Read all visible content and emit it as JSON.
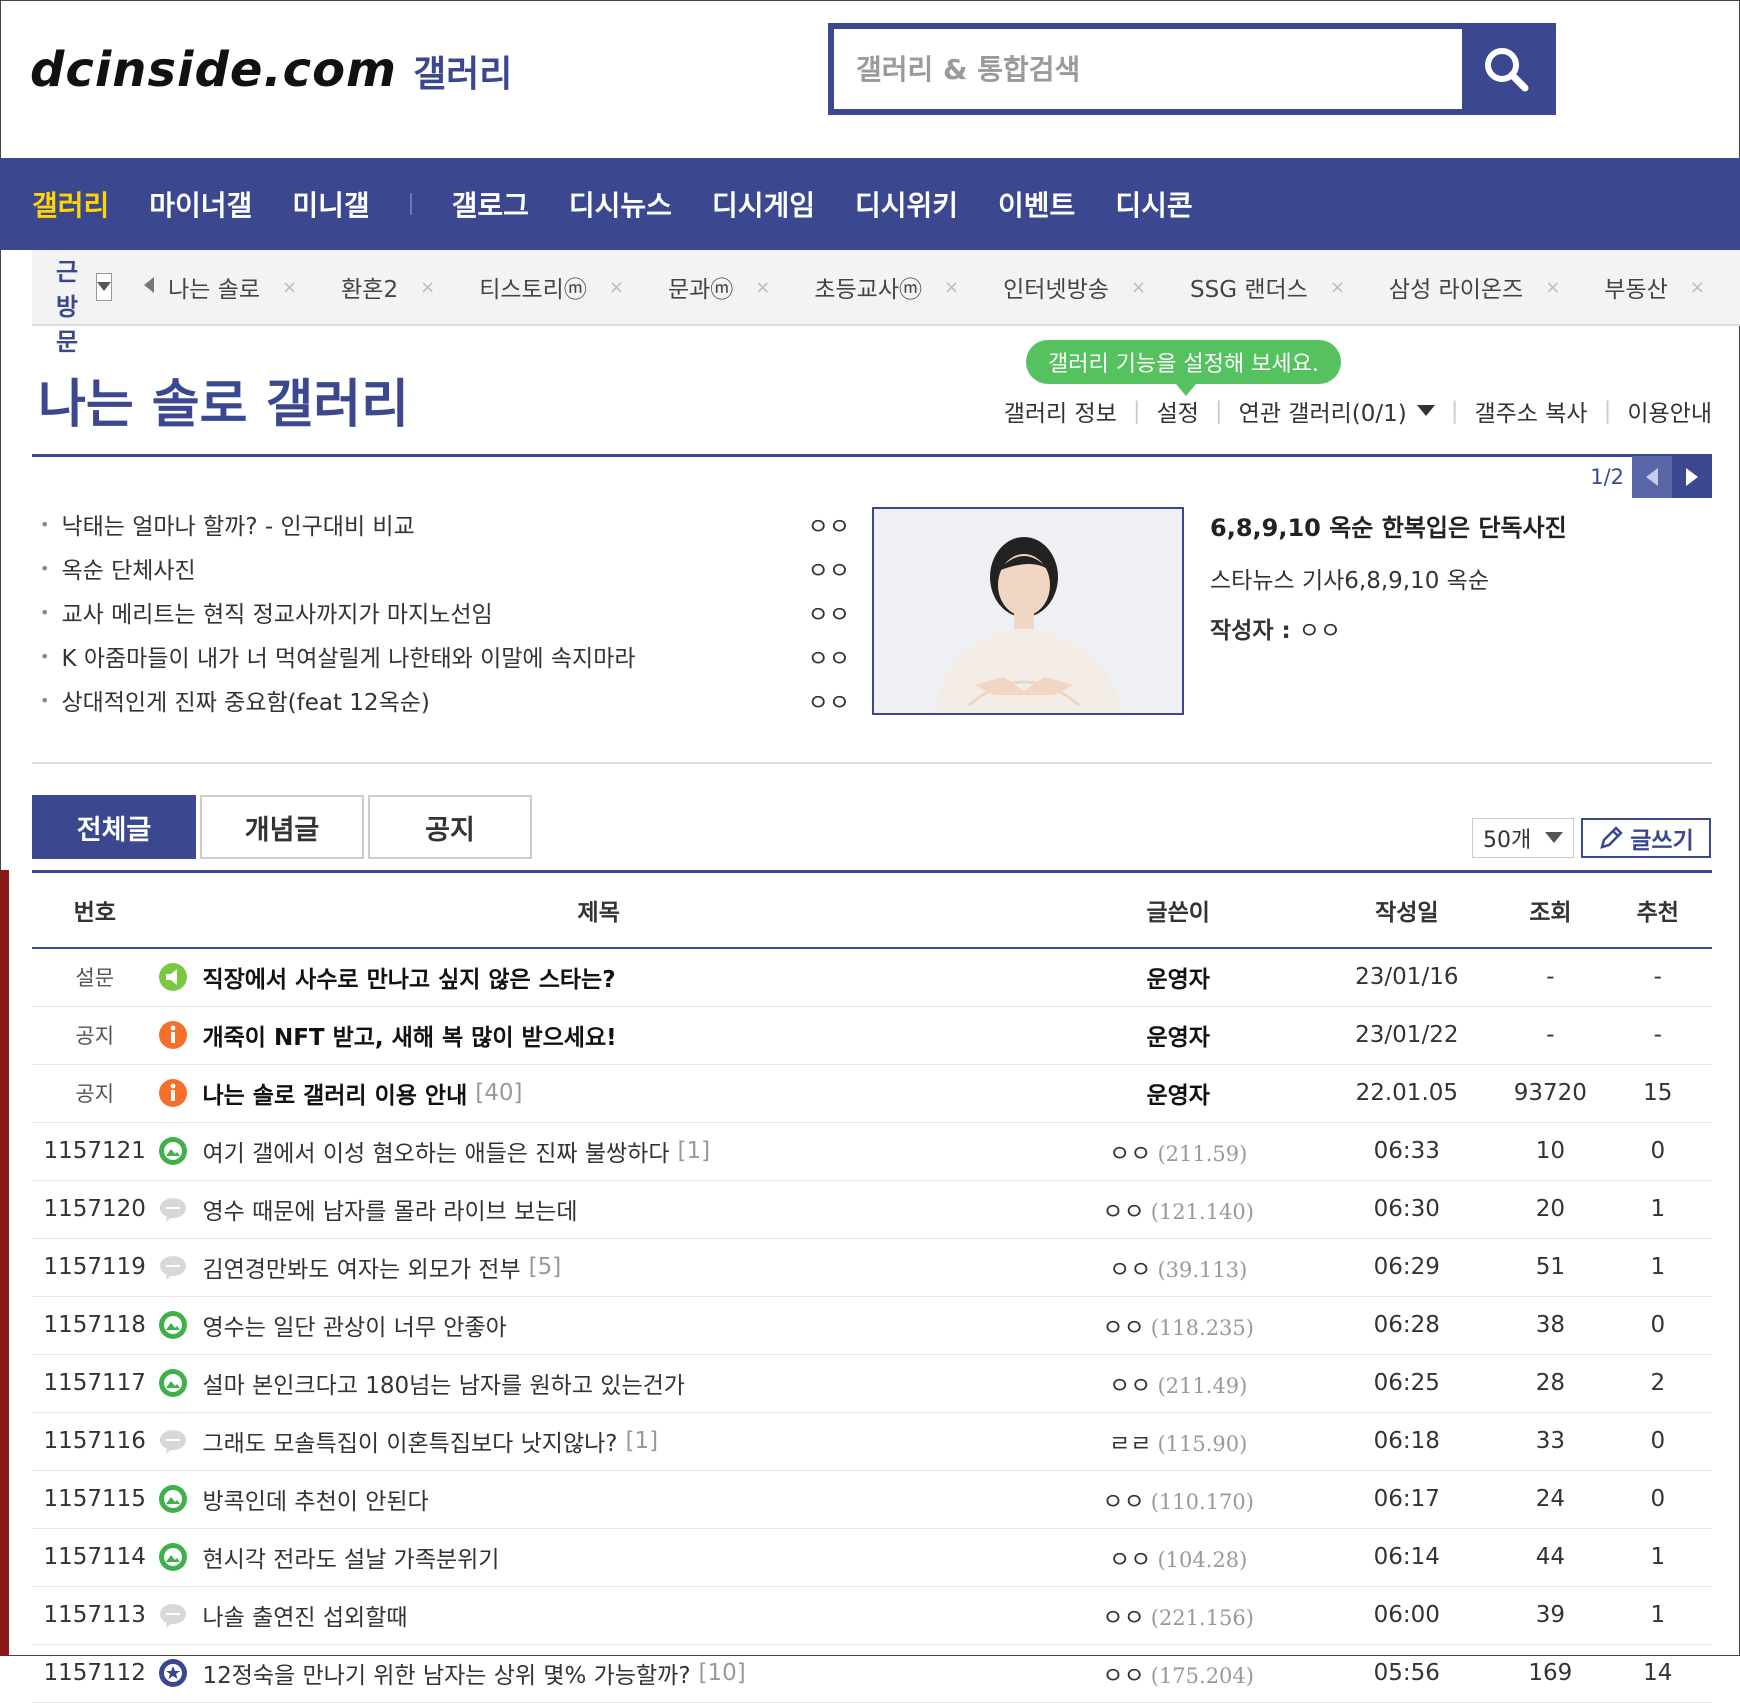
{
  "header": {
    "logo_text": "dcinside.com",
    "logo_sub": "갤러리",
    "search_placeholder": "갤러리 & 통합검색",
    "search_icon": "search-icon"
  },
  "gnb": {
    "items": [
      "갤러리",
      "마이너갤",
      "미니갤",
      "갤로그",
      "디시뉴스",
      "디시게임",
      "디시위키",
      "이벤트",
      "디시콘"
    ]
  },
  "recent": {
    "label": "최근 방문",
    "items": [
      "나는 솔로",
      "환혼2",
      "티스토리ⓜ",
      "문과ⓜ",
      "초등교사ⓜ",
      "인터넷방송",
      "SSG 랜더스",
      "삼성 라이온즈",
      "부동산"
    ],
    "remove_glyph": "×"
  },
  "gallery": {
    "title": "나는 솔로 갤러리",
    "tooltip": "갤러리 기능을 설정해 보세요.",
    "links": [
      "갤러리 정보",
      "설정",
      "연관 갤러리(0/1)",
      "갤주소 복사",
      "이용안내"
    ]
  },
  "featured": {
    "page_indicator": "1/2",
    "issues": [
      {
        "title": "낙태는 얼마나 할까? - 인구대비 비교",
        "writer": "ㅇㅇ"
      },
      {
        "title": "옥순 단체사진",
        "writer": "ㅇㅇ"
      },
      {
        "title": "교사 메리트는 현직 정교사까지가 마지노선임",
        "writer": "ㅇㅇ"
      },
      {
        "title": "K 아줌마들이 내가 너 먹여살릴게 나한태와 이말에 속지마라",
        "writer": "ㅇㅇ"
      },
      {
        "title": "상대적인게 진짜 중요함(feat 12옥순)",
        "writer": "ㅇㅇ"
      }
    ],
    "headline": "6,8,9,10 옥순 한복입은 단독사진",
    "desc": "스타뉴스 기사6,8,9,10 옥순",
    "author_label": "작성자",
    "author_sep": " : ",
    "author": "ㅇㅇ"
  },
  "tabs": [
    "전체글",
    "개념글",
    "공지"
  ],
  "list_size": "50개",
  "write_label": "글쓰기",
  "board": {
    "columns": [
      "번호",
      "제목",
      "글쓴이",
      "작성일",
      "조회",
      "추천"
    ],
    "rows": [
      {
        "num": "설문",
        "icon": "survey",
        "title": "직장에서 사수로 만나고 싶지 않은 스타는?",
        "reply": "",
        "writer": "운영자",
        "ip": "",
        "date": "23/01/16",
        "views": "-",
        "rec": "-",
        "bold": true
      },
      {
        "num": "공지",
        "icon": "notice",
        "title": "개죽이 NFT 받고, 새해 복 많이 받으세요!",
        "reply": "",
        "writer": "운영자",
        "ip": "",
        "date": "23/01/22",
        "views": "-",
        "rec": "-",
        "bold": true
      },
      {
        "num": "공지",
        "icon": "notice",
        "title": "나는 솔로 갤러리 이용 안내",
        "reply": "[40]",
        "writer": "운영자",
        "ip": "",
        "date": "22.01.05",
        "views": "93720",
        "rec": "15",
        "bold": true
      },
      {
        "num": "1157121",
        "icon": "image",
        "title": "여기 갤에서 이성 혐오하는 애들은 진짜 불쌍하다",
        "reply": "[1]",
        "writer": "ㅇㅇ",
        "ip": "(211.59)",
        "date": "06:33",
        "views": "10",
        "rec": "0",
        "bold": false
      },
      {
        "num": "1157120",
        "icon": "text",
        "title": "영수 때문에 남자를 몰라 라이브 보는데",
        "reply": "",
        "writer": "ㅇㅇ",
        "ip": "(121.140)",
        "date": "06:30",
        "views": "20",
        "rec": "1",
        "bold": false
      },
      {
        "num": "1157119",
        "icon": "text",
        "title": "김연경만봐도 여자는 외모가 전부",
        "reply": "[5]",
        "writer": "ㅇㅇ",
        "ip": "(39.113)",
        "date": "06:29",
        "views": "51",
        "rec": "1",
        "bold": false
      },
      {
        "num": "1157118",
        "icon": "image",
        "title": "영수는 일단 관상이 너무 안좋아",
        "reply": "",
        "writer": "ㅇㅇ",
        "ip": "(118.235)",
        "date": "06:28",
        "views": "38",
        "rec": "0",
        "bold": false
      },
      {
        "num": "1157117",
        "icon": "image",
        "title": "설마 본인크다고 180넘는 남자를 원하고 있는건가",
        "reply": "",
        "writer": "ㅇㅇ",
        "ip": "(211.49)",
        "date": "06:25",
        "views": "28",
        "rec": "2",
        "bold": false
      },
      {
        "num": "1157116",
        "icon": "text",
        "title": "그래도 모솔특집이 이혼특집보다 낫지않나?",
        "reply": "[1]",
        "writer": "ㄹㄹ",
        "ip": "(115.90)",
        "date": "06:18",
        "views": "33",
        "rec": "0",
        "bold": false
      },
      {
        "num": "1157115",
        "icon": "image",
        "title": "방콕인데 추천이 안된다",
        "reply": "",
        "writer": "ㅇㅇ",
        "ip": "(110.170)",
        "date": "06:17",
        "views": "24",
        "rec": "0",
        "bold": false
      },
      {
        "num": "1157114",
        "icon": "image",
        "title": "현시각 전라도 설날 가족분위기",
        "reply": "",
        "writer": "ㅇㅇ",
        "ip": "(104.28)",
        "date": "06:14",
        "views": "44",
        "rec": "1",
        "bold": false
      },
      {
        "num": "1157113",
        "icon": "text",
        "title": "나솔 출연진 섭외할때",
        "reply": "",
        "writer": "ㅇㅇ",
        "ip": "(221.156)",
        "date": "06:00",
        "views": "39",
        "rec": "1",
        "bold": false
      },
      {
        "num": "1157112",
        "icon": "recommend",
        "title": "12정숙을 만나기 위한 남자는 상위 몇% 가능할까?",
        "reply": "[10]",
        "writer": "ㅇㅇ",
        "ip": "(175.204)",
        "date": "05:56",
        "views": "169",
        "rec": "14",
        "bold": false
      }
    ]
  },
  "colors": {
    "brand": "#3b4890",
    "active_nav": "#ffd600",
    "tooltip": "#56c25f",
    "notice_icon": "#f36f2a",
    "image_icon": "#3fb04a"
  }
}
